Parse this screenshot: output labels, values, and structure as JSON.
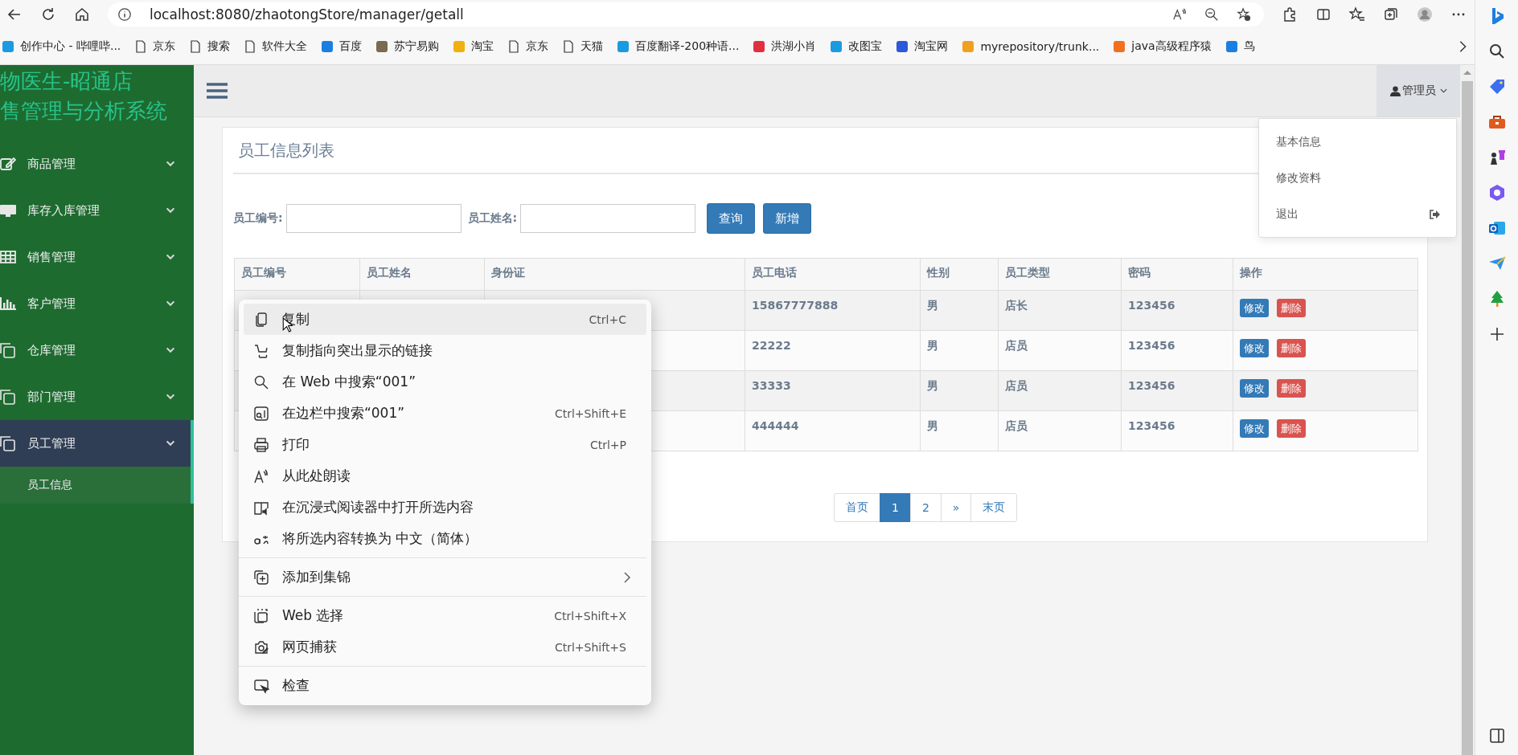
{
  "browser": {
    "url": "localhost:8080/zhaotongStore/manager/getall",
    "bookmarks": [
      {
        "label": "创作中心 - 哔哩哔...",
        "kind": "site"
      },
      {
        "label": "京东",
        "kind": "page"
      },
      {
        "label": "搜索",
        "kind": "page"
      },
      {
        "label": "软件大全",
        "kind": "page"
      },
      {
        "label": "百度",
        "kind": "site"
      },
      {
        "label": "苏宁易购",
        "kind": "site"
      },
      {
        "label": "淘宝",
        "kind": "site"
      },
      {
        "label": "京东",
        "kind": "page"
      },
      {
        "label": "天猫",
        "kind": "page"
      },
      {
        "label": "百度翻译-200种语...",
        "kind": "site"
      },
      {
        "label": "洪湖小肖",
        "kind": "site"
      },
      {
        "label": "改图宝",
        "kind": "site"
      },
      {
        "label": "淘宝网",
        "kind": "site"
      },
      {
        "label": "myrepository/trunk...",
        "kind": "site"
      },
      {
        "label": "java高级程序猿",
        "kind": "site"
      },
      {
        "label": "鸟",
        "kind": "site"
      }
    ]
  },
  "sidebar": {
    "title_lines": [
      "物医生-昭通店",
      "售管理与分析系统"
    ],
    "items": [
      {
        "label": "商品管理",
        "selected": false
      },
      {
        "label": "库存入库管理",
        "selected": false
      },
      {
        "label": "销售管理",
        "selected": false
      },
      {
        "label": "客户管理",
        "selected": false
      },
      {
        "label": "仓库管理",
        "selected": false
      },
      {
        "label": "部门管理",
        "selected": false
      },
      {
        "label": "员工管理",
        "selected": true,
        "children": [
          {
            "label": "员工信息",
            "selected": true
          }
        ]
      }
    ]
  },
  "navbar": {
    "user": "管理员",
    "user_menu": {
      "expanded": true,
      "items": [
        {
          "label": "基本信息"
        },
        {
          "label": "修改资料"
        },
        {
          "label": "退出"
        }
      ]
    }
  },
  "panel": {
    "title": "员工信息列表",
    "filters": [
      {
        "label": "员工编号:"
      },
      {
        "label": "员工姓名:"
      }
    ],
    "buttons": [
      {
        "label": "查询"
      },
      {
        "label": "新增"
      }
    ]
  },
  "table": {
    "columns": [
      "员工编号",
      "员工姓名",
      "身份证",
      "员工电话",
      "性别",
      "员工类型",
      "密码",
      "操作"
    ],
    "rows": [
      {
        "phone": "15867777888",
        "gender": "男",
        "type": "店长",
        "password": "123456",
        "actions": [
          {
            "label": "修改",
            "kind": "edit"
          },
          {
            "label": "删除",
            "kind": "delete"
          }
        ]
      },
      {
        "phone": "22222",
        "gender": "男",
        "type": "店员",
        "password": "123456",
        "actions": [
          {
            "label": "修改",
            "kind": "edit"
          },
          {
            "label": "删除",
            "kind": "delete"
          }
        ]
      },
      {
        "phone": "33333",
        "gender": "男",
        "type": "店员",
        "password": "123456",
        "actions": [
          {
            "label": "修改",
            "kind": "edit"
          },
          {
            "label": "删除",
            "kind": "delete"
          }
        ]
      },
      {
        "phone": "444444",
        "gender": "男",
        "type": "店员",
        "password": "123456",
        "actions": [
          {
            "label": "修改",
            "kind": "edit"
          },
          {
            "label": "删除",
            "kind": "delete"
          }
        ]
      }
    ]
  },
  "pagination": [
    {
      "label": "首页",
      "selected": false
    },
    {
      "label": "1",
      "selected": true
    },
    {
      "label": "2",
      "selected": false
    },
    {
      "label": "»",
      "selected": false
    },
    {
      "label": "末页",
      "selected": false
    }
  ],
  "context_menu": {
    "groups": [
      [
        {
          "label": "复制",
          "shortcut": "Ctrl+C",
          "highlighted": true,
          "kind": "item"
        },
        {
          "label": "复制指向突出显示的链接",
          "highlighted": false,
          "kind": "item"
        },
        {
          "label": "在 Web 中搜索“001”",
          "highlighted": false,
          "kind": "item"
        },
        {
          "label": "在边栏中搜索“001”",
          "shortcut": "Ctrl+Shift+E",
          "highlighted": false,
          "kind": "item"
        },
        {
          "label": "打印",
          "shortcut": "Ctrl+P",
          "highlighted": false,
          "kind": "item"
        },
        {
          "label": "从此处朗读",
          "highlighted": false,
          "kind": "item"
        },
        {
          "label": "在沉浸式阅读器中打开所选内容",
          "highlighted": false,
          "kind": "item"
        },
        {
          "label": "将所选内容转换为 中文（简体）",
          "highlighted": false,
          "kind": "item"
        }
      ],
      [
        {
          "label": "添加到集锦",
          "highlighted": false,
          "kind": "submenu"
        }
      ],
      [
        {
          "label": "Web 选择",
          "shortcut": "Ctrl+Shift+X",
          "highlighted": false,
          "kind": "item"
        },
        {
          "label": "网页捕获",
          "shortcut": "Ctrl+Shift+S",
          "highlighted": false,
          "kind": "item"
        }
      ],
      [
        {
          "label": "检查",
          "highlighted": false,
          "kind": "item"
        }
      ]
    ]
  }
}
